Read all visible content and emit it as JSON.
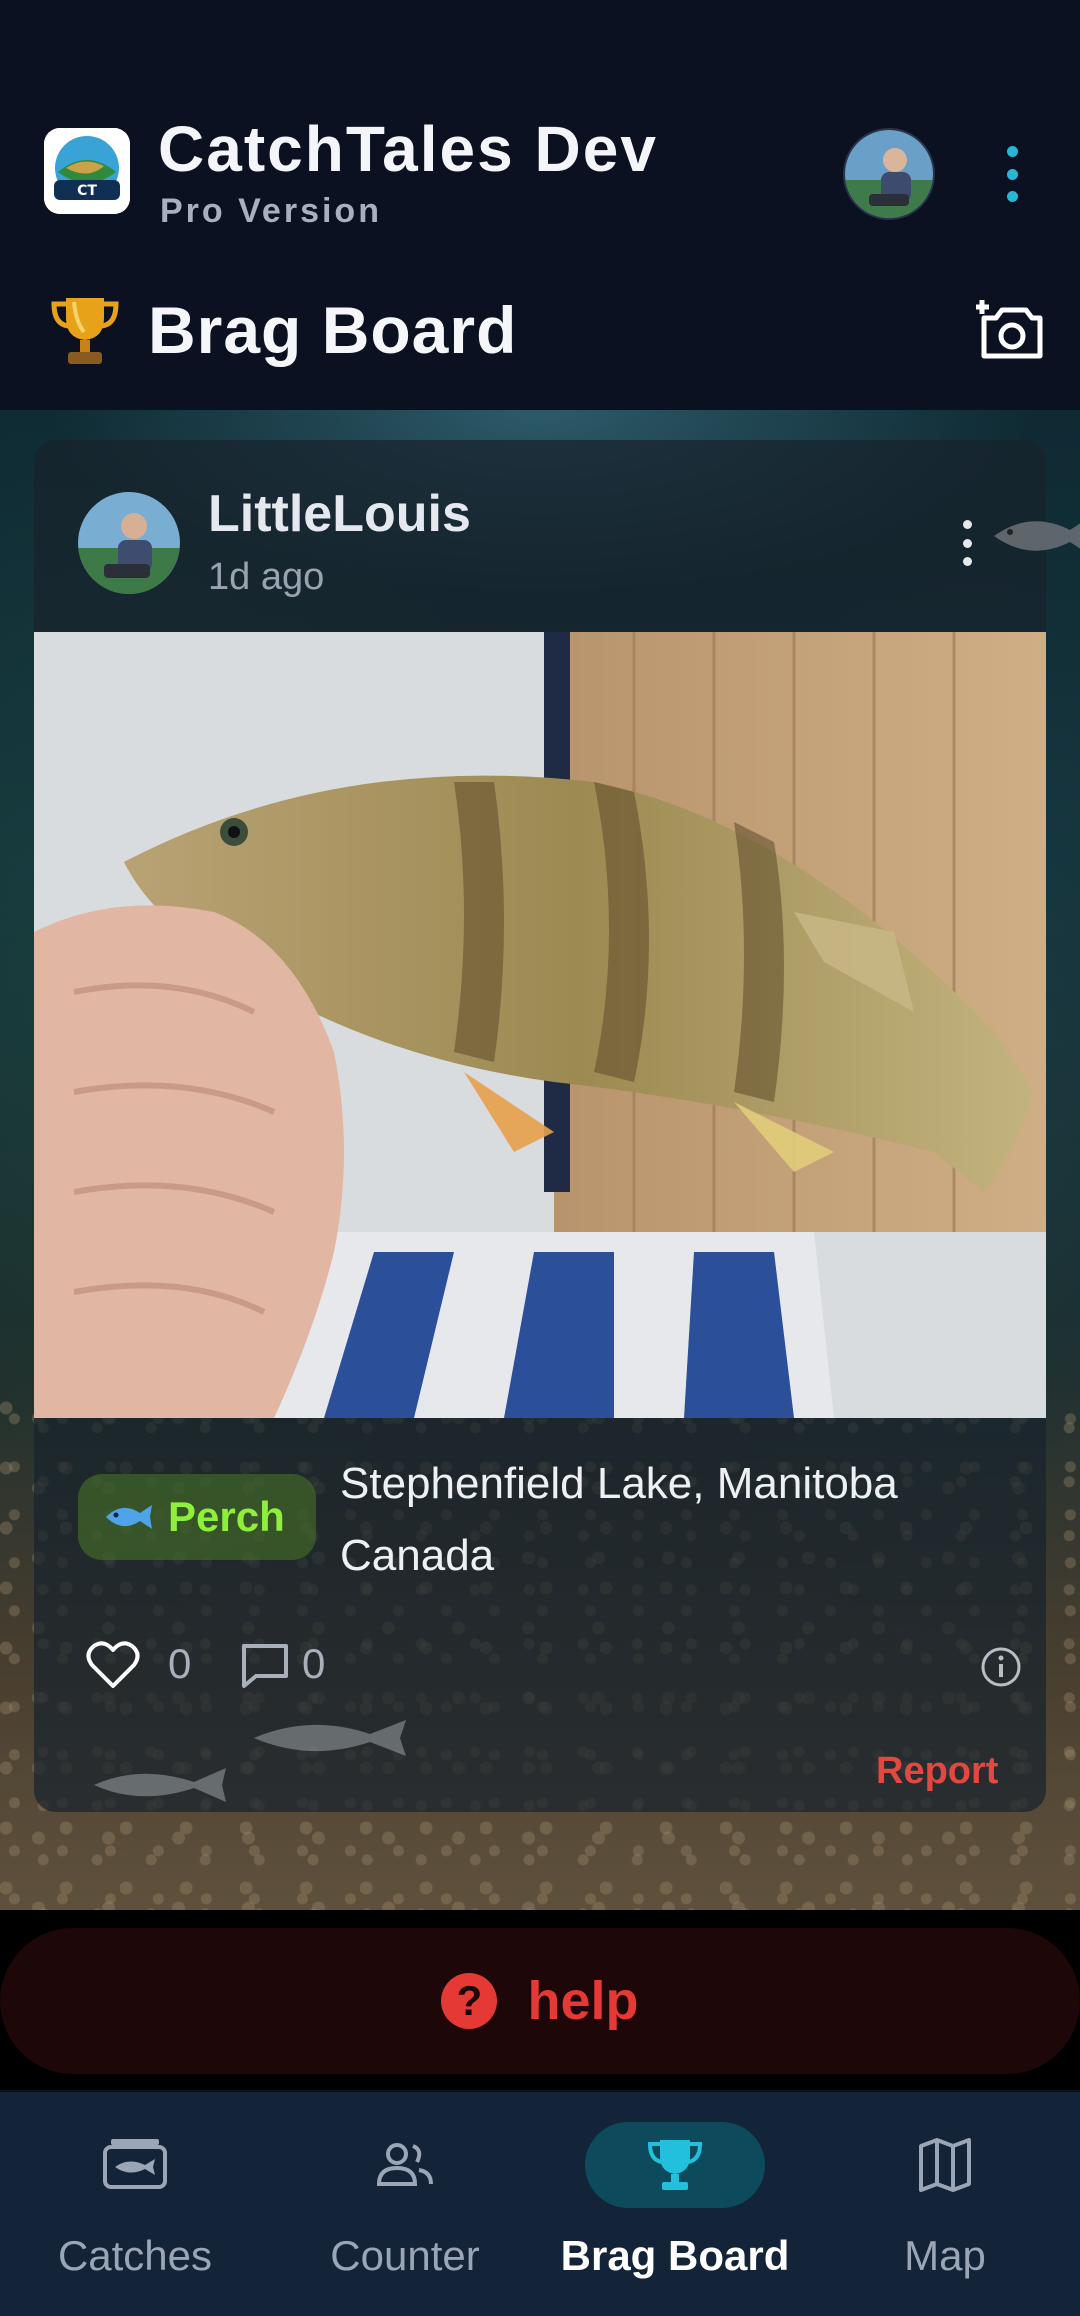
{
  "header": {
    "app_title": "CatchTales Dev",
    "app_subtitle": "Pro Version",
    "page_title": "Brag Board",
    "accent_color": "#27b6d3"
  },
  "post": {
    "username": "LittleLouis",
    "time_ago": "1d ago",
    "species": "Perch",
    "location": "Stephenfield Lake, Manitoba Canada",
    "likes": "0",
    "comments": "0",
    "report_label": "Report",
    "report_color": "#e2483f"
  },
  "help": {
    "label": "help",
    "icon": "?"
  },
  "bottom_nav": {
    "items": [
      {
        "label": "Catches",
        "icon": "catches-icon",
        "active": false
      },
      {
        "label": "Counter",
        "icon": "people-icon",
        "active": false
      },
      {
        "label": "Brag Board",
        "icon": "trophy-icon",
        "active": true
      },
      {
        "label": "Map",
        "icon": "map-icon",
        "active": false
      }
    ]
  }
}
